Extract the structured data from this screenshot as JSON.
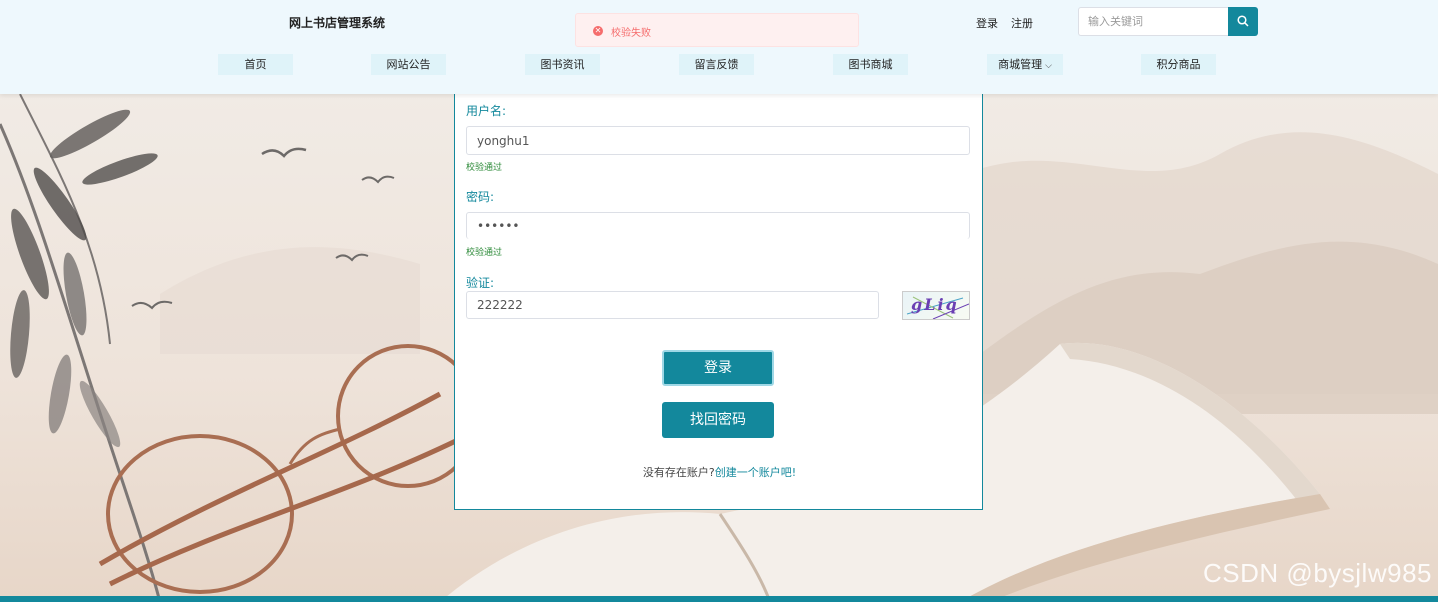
{
  "header": {
    "site_title": "网上书店管理系统",
    "toast": {
      "message": "校验失败",
      "type": "error"
    },
    "login_link": "登录",
    "register_link": "注册",
    "search": {
      "placeholder": "输入关键词",
      "value": ""
    },
    "nav": [
      "首页",
      "网站公告",
      "图书资讯",
      "留言反馈",
      "图书商城",
      "商城管理",
      "积分商品"
    ]
  },
  "form": {
    "username": {
      "label": "用户名:",
      "value": "yonghu1",
      "status": "校验通过"
    },
    "password": {
      "label": "密码:",
      "value": "••••••",
      "status": "校验通过"
    },
    "captcha": {
      "label": "验证:",
      "value": "222222",
      "image_text": "gLiq"
    },
    "login_button": "登录",
    "forgot_button": "找回密码",
    "register_prompt": "没有存在账户?",
    "register_link": "创建一个账户吧!"
  },
  "watermark": "CSDN @bysjlw985",
  "colors": {
    "primary": "#13889c",
    "error": "#f56c6c",
    "success": "#2e8b3a",
    "header_bg": "#eef8fd",
    "nav_item_bg": "#dff3f9"
  }
}
